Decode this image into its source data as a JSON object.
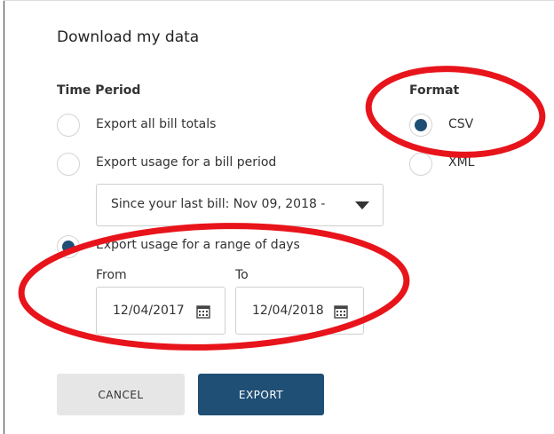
{
  "dialog": {
    "title": "Download my data"
  },
  "time_period": {
    "label": "Time Period",
    "options": [
      {
        "label": "Export all bill totals",
        "checked": false
      },
      {
        "label": "Export usage for a bill period",
        "checked": false
      },
      {
        "label": "Export usage for a range of days",
        "checked": true
      }
    ],
    "bill_period_select": {
      "value": "Since your last bill: Nov 09, 2018 - "
    },
    "range": {
      "from_label": "From",
      "to_label": "To",
      "from_value": "12/04/2017",
      "to_value": "12/04/2018"
    }
  },
  "format": {
    "label": "Format",
    "options": [
      {
        "label": "CSV",
        "checked": true
      },
      {
        "label": "XML",
        "checked": false
      }
    ]
  },
  "buttons": {
    "cancel_label": "CANCEL",
    "export_label": "EXPORT"
  },
  "colors": {
    "accent": "#1f4f75",
    "annotation": "#e8141b",
    "cancel_bg": "#e6e6e6"
  },
  "icons": {
    "calendar": "calendar-icon",
    "dropdown": "chevron-down-icon"
  }
}
